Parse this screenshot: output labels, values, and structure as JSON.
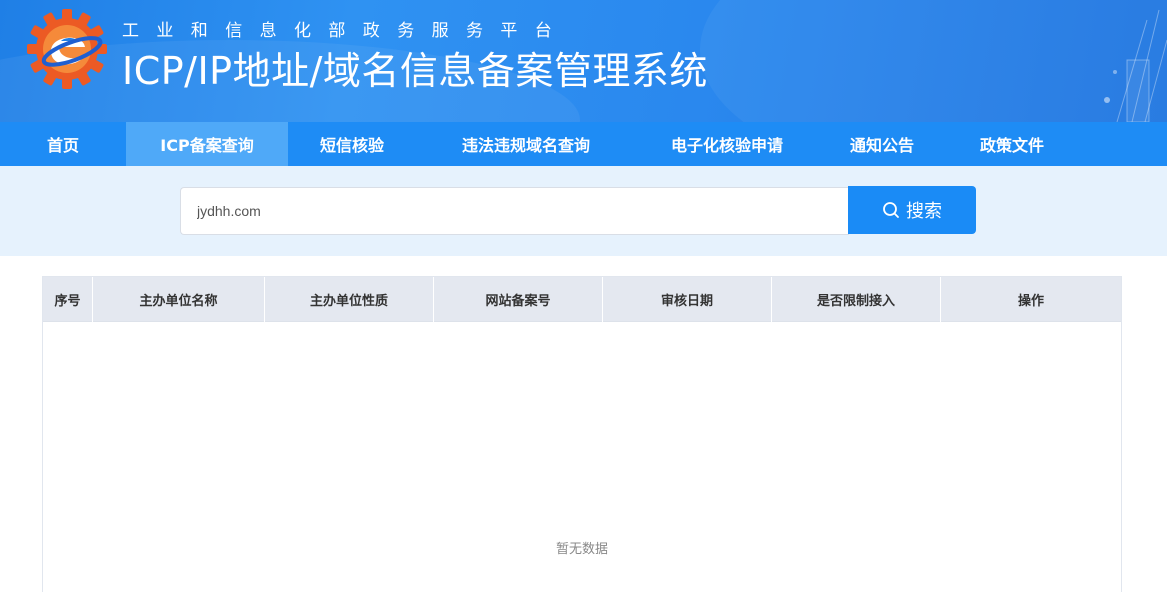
{
  "header": {
    "subtitle": "工业和信息化部政务服务平台",
    "title": "ICP/IP地址/域名信息备案管理系统",
    "logo_icon": "ministry-gear-logo"
  },
  "nav": {
    "items": [
      {
        "label": "首页"
      },
      {
        "label": "ICP备案查询",
        "active": true
      },
      {
        "label": "短信核验"
      },
      {
        "label": "违法违规域名查询"
      },
      {
        "label": "电子化核验申请"
      },
      {
        "label": "通知公告"
      },
      {
        "label": "政策文件"
      }
    ]
  },
  "search": {
    "value": "jydhh.com",
    "button_label": "搜索",
    "icon": "search-icon"
  },
  "table": {
    "columns": [
      "序号",
      "主办单位名称",
      "主办单位性质",
      "网站备案号",
      "审核日期",
      "是否限制接入",
      "操作"
    ],
    "empty_text": "暂无数据"
  },
  "colors": {
    "header_blue": "#2a88ee",
    "nav_blue": "#1e8cf5",
    "nav_active": "#4fa9f8",
    "search_button": "#1a8bf6",
    "search_band": "#e6f2fd",
    "table_header": "#e4e8f0"
  }
}
